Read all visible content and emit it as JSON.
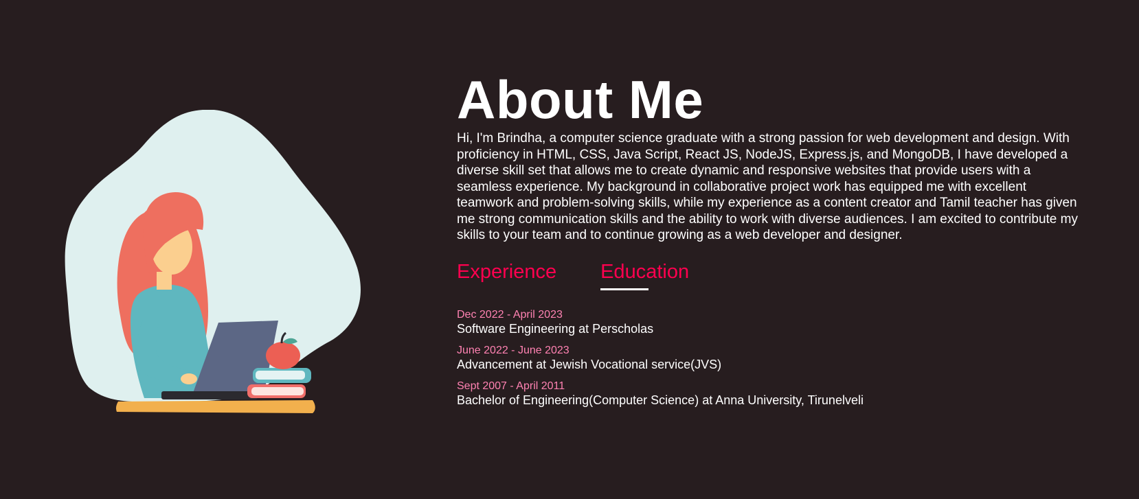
{
  "about": {
    "title": "About Me",
    "bio": "Hi, I'm Brindha, a computer science graduate with a strong passion for web development and design. With proficiency in HTML, CSS, Java Script, React JS, NodeJS, Express.js, and MongoDB, I have developed a diverse skill set that allows me to create dynamic and responsive websites that provide users with a seamless experience. My background in collaborative project work has equipped me with excellent teamwork and problem-solving skills, while my experience as a content creator and Tamil teacher has given me strong communication skills and the ability to work with diverse audiences. I am excited to contribute my skills to your team and to continue growing as a web developer and designer."
  },
  "tabs": [
    {
      "label": "Experience",
      "active": false
    },
    {
      "label": "Education",
      "active": true
    }
  ],
  "entries": [
    {
      "date": "Dec 2022 - April 2023",
      "title": "Software Engineering at Perscholas"
    },
    {
      "date": "June 2022 - June 2023",
      "title": "Advancement at Jewish Vocational service(JVS)"
    },
    {
      "date": "Sept 2007 - April 2011",
      "title": "Bachelor of Engineering(Computer Science) at Anna University, Tirunelveli"
    }
  ],
  "colors": {
    "background": "#271d1f",
    "accent": "#ff004f",
    "date": "#ff82b2",
    "text": "#ffffff"
  },
  "illustration": {
    "icon": "woman-at-laptop-illustration"
  }
}
